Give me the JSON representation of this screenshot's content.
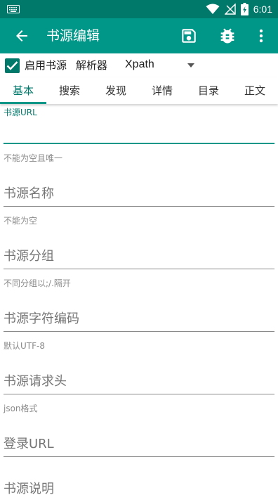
{
  "statusbar": {
    "time": "6:01"
  },
  "toolbar": {
    "title": "书源编辑"
  },
  "options": {
    "enable_label": "启用书源",
    "enabled": true,
    "parser_label": "解析器",
    "parser_value": "Xpath"
  },
  "tabs": [
    {
      "label": "基本",
      "active": true
    },
    {
      "label": "搜索"
    },
    {
      "label": "发现"
    },
    {
      "label": "详情"
    },
    {
      "label": "目录"
    },
    {
      "label": "正文"
    }
  ],
  "fields": {
    "source_url": {
      "label": "书源URL",
      "help": "不能为空且唯一"
    },
    "source_name": {
      "hint": "书源名称",
      "help": "不能为空"
    },
    "source_group": {
      "hint": "书源分组",
      "help": "不同分组以;/.隔开"
    },
    "source_charset": {
      "hint": "书源字符编码",
      "help": "默认UTF-8"
    },
    "source_header": {
      "hint": "书源请求头",
      "help": "json格式"
    },
    "login_url": {
      "hint": "登录URL"
    },
    "source_desc": {
      "hint": "书源说明"
    }
  },
  "colors": {
    "primary": "#009688",
    "primary_dark": "#00796b"
  }
}
